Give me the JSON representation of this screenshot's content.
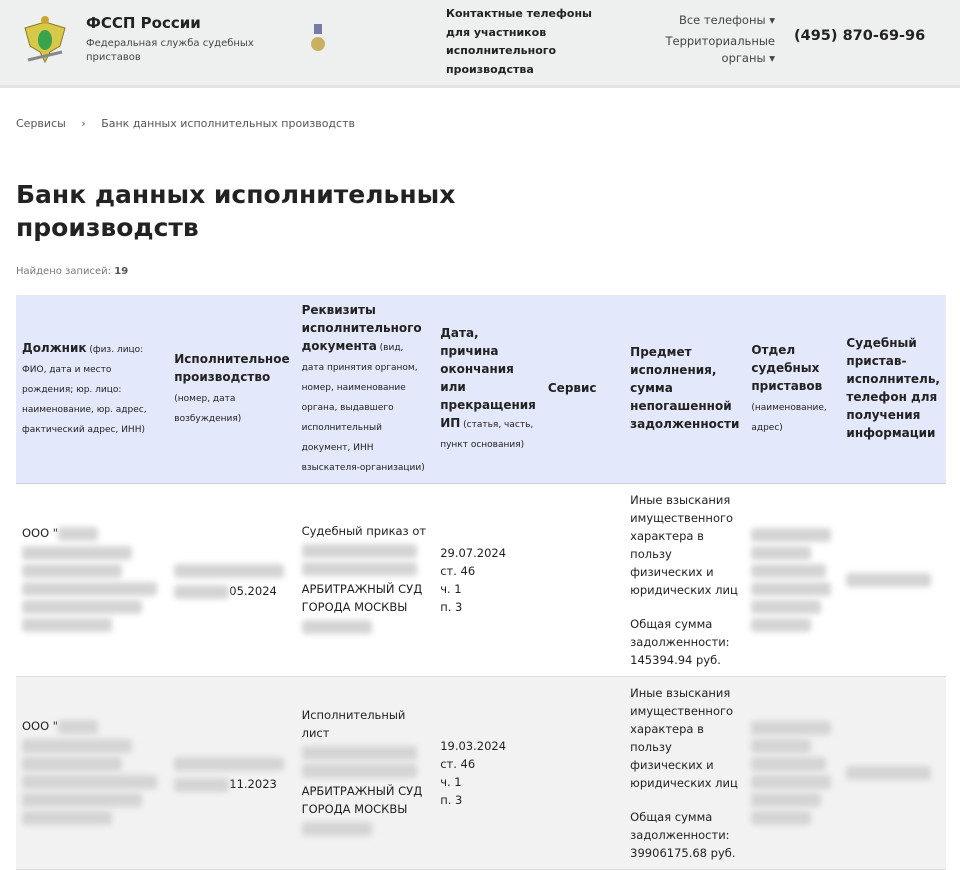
{
  "header": {
    "title": "ФССП России",
    "subtitle": "Федеральная служба судебных приставов",
    "contacts": "Контактные телефоны для участников исполнительного производства",
    "all_phones": "Все телефоны",
    "territorial": "Территориальные органы",
    "phone": "(495) 870-69-96"
  },
  "breadcrumb": {
    "items": [
      "Сервисы",
      "Банк данных исполнительных производств"
    ],
    "separator": "›"
  },
  "page": {
    "title": "Банк данных исполнительных производств",
    "found_label": "Найдено записей:",
    "found_count": "19"
  },
  "table": {
    "headers": [
      {
        "bold": "Должник",
        "note": " (физ. лицо: ФИО, дата и место рождения; юр. лицо: наименование, юр. адрес, фактический адрес, ИНН)"
      },
      {
        "bold": "Исполнительное производство",
        "note": " (номер, дата возбуждения)"
      },
      {
        "bold": "Реквизиты исполнительного документа",
        "note": " (вид, дата принятия органом, номер, наименование органа, выдавшего исполнительный документ, ИНН взыскателя-организации)"
      },
      {
        "bold": "Дата, причина окончания или прекращения ИП",
        "note": " (статья, часть, пункт основания)"
      },
      {
        "bold": "Сервис",
        "note": ""
      },
      {
        "bold": "Предмет исполнения, сумма непогашенной задолженности",
        "note": ""
      },
      {
        "bold": "Отдел судебных приставов",
        "note": " (наименование, адрес)"
      },
      {
        "bold": "Судебный пристав-исполнитель, телефон для получения информации",
        "note": ""
      }
    ],
    "rows": [
      {
        "debtor": "ООО \"",
        "ip_date": "05.2024",
        "doc_type": "Судебный приказ от",
        "court": "АРБИТРАЖНЫЙ СУД ГОРОДА МОСКВЫ",
        "end_date": "29.07.2024",
        "article": "ст. 46",
        "part": "ч. 1",
        "point": "п. 3",
        "subject": "Иные взыскания имущественного характера в пользу физических и юридических лиц",
        "debt_label": "Общая сумма задолженности:",
        "debt": "145394.94 руб."
      },
      {
        "debtor": "ООО \"",
        "ip_date": "11.2023",
        "doc_type": "Исполнительный лист",
        "court": "АРБИТРАЖНЫЙ СУД ГОРОДА МОСКВЫ",
        "end_date": "19.03.2024",
        "article": "ст. 46",
        "part": "ч. 1",
        "point": "п. 3",
        "subject": "Иные взыскания имущественного характера в пользу физических и юридических лиц",
        "debt_label": "Общая сумма задолженности:",
        "debt": "39906175.68 руб."
      }
    ]
  }
}
